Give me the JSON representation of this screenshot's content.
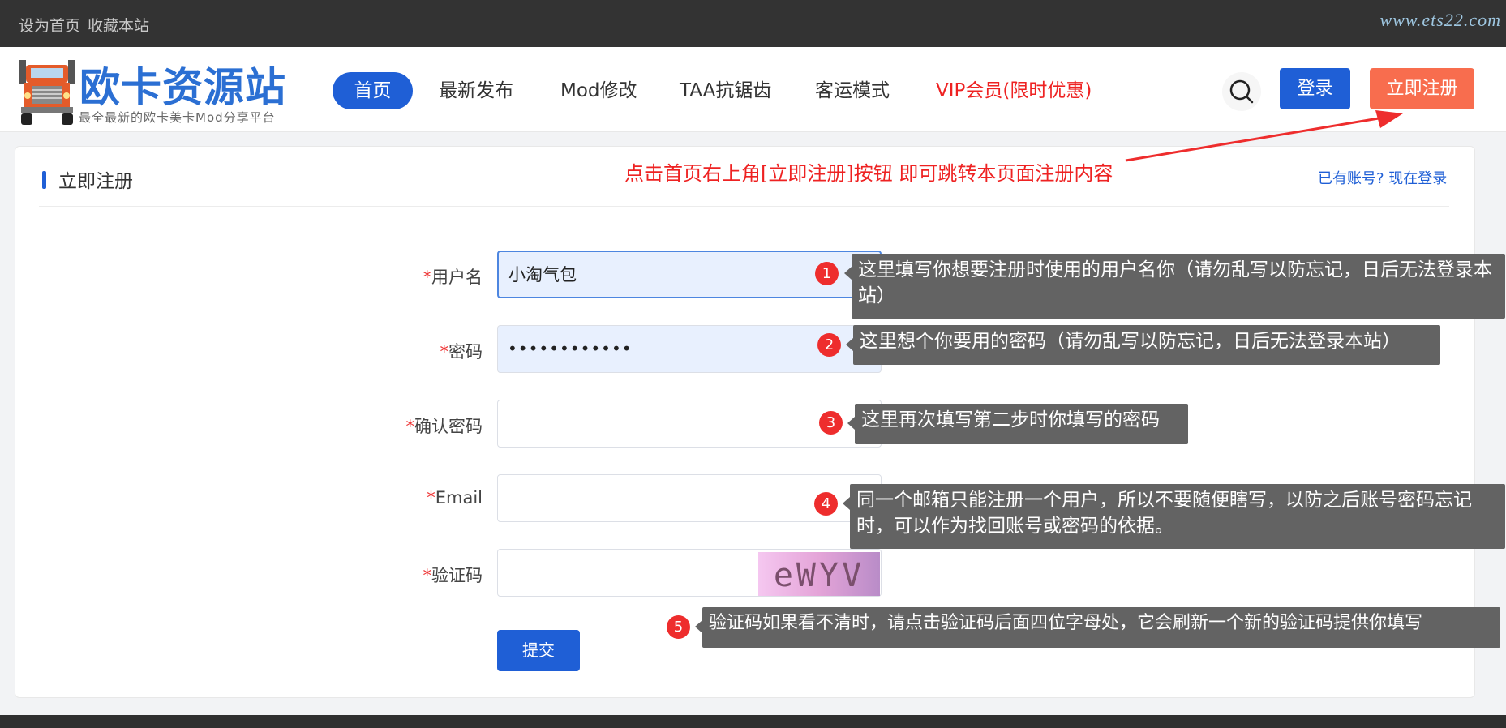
{
  "topbar": {
    "set_home": "设为首页",
    "bookmark": "收藏本站",
    "site_url": "www.ets22.com"
  },
  "header": {
    "logo_title": "欧卡资源站",
    "logo_subtitle": "最全最新的欧卡美卡Mod分享平台",
    "nav": [
      "首页",
      "最新发布",
      "Mod修改",
      "TAA抗锯齿",
      "客运模式",
      "VIP会员(限时优惠)"
    ],
    "login_label": "登录",
    "register_label": "立即注册"
  },
  "card": {
    "title": "立即注册",
    "have_account": "已有账号? 现在登录",
    "red_note": "点击首页右上角[立即注册]按钮 即可跳转本页面注册内容"
  },
  "form": {
    "required_mark": "*",
    "username_label": "用户名",
    "username_value": "小淘气包",
    "password_label": "密码",
    "password_value": "••••••••••••",
    "confirm_label": "确认密码",
    "email_label": "Email",
    "captcha_label": "验证码",
    "captcha_text": "eWYV",
    "submit_label": "提交"
  },
  "annotations": [
    {
      "num": "1",
      "text": "这里填写你想要注册时使用的用户名你（请勿乱写以防忘记，日后无法登录本站）"
    },
    {
      "num": "2",
      "text": "这里想个你要用的密码（请勿乱写以防忘记，日后无法登录本站）"
    },
    {
      "num": "3",
      "text": "这里再次填写第二步时你填写的密码"
    },
    {
      "num": "4",
      "text": "同一个邮箱只能注册一个用户，所以不要随便瞎写，以防之后账号密码忘记时，可以作为找回账号或密码的依据。"
    },
    {
      "num": "5",
      "text": "验证码如果看不清时，请点击验证码后面四位字母处，它会刷新一个新的验证码提供你填写"
    }
  ],
  "colors": {
    "primary": "#1f5fd6",
    "register": "#f86d4e",
    "highlight_red": "#ee2222",
    "callout_bg": "#636363"
  }
}
